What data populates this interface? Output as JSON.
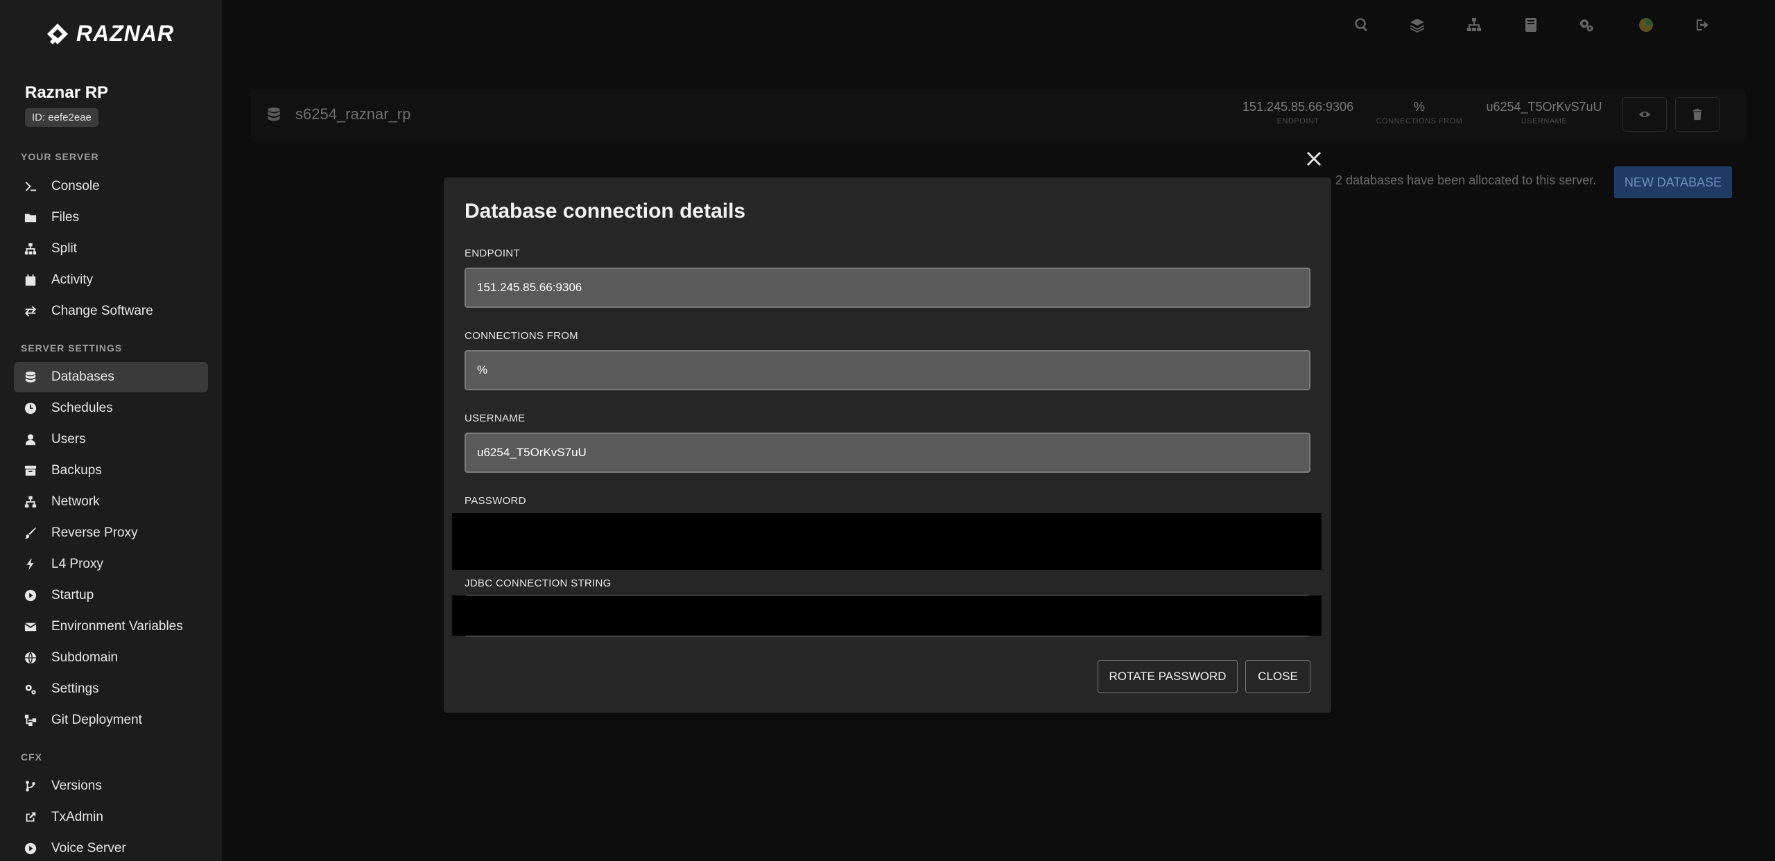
{
  "brand": {
    "logo_text": "RAZNAR"
  },
  "server": {
    "name": "Raznar RP",
    "id_badge": "ID: eefe2eae"
  },
  "sidebar": {
    "sections": [
      {
        "title": "YOUR SERVER"
      },
      {
        "title": "SERVER SETTINGS"
      },
      {
        "title": "CFX"
      }
    ],
    "items": [
      {
        "label": "Console",
        "icon": "terminal-icon"
      },
      {
        "label": "Files",
        "icon": "folder-icon"
      },
      {
        "label": "Split",
        "icon": "sitemap-icon"
      },
      {
        "label": "Activity",
        "icon": "calendar-icon"
      },
      {
        "label": "Change Software",
        "icon": "exchange-icon"
      },
      {
        "label": "Databases",
        "icon": "database-icon",
        "active": true
      },
      {
        "label": "Schedules",
        "icon": "clock-icon"
      },
      {
        "label": "Users",
        "icon": "user-icon"
      },
      {
        "label": "Backups",
        "icon": "archive-icon"
      },
      {
        "label": "Network",
        "icon": "network-icon"
      },
      {
        "label": "Reverse Proxy",
        "icon": "brush-icon"
      },
      {
        "label": "L4 Proxy",
        "icon": "bolt-icon"
      },
      {
        "label": "Startup",
        "icon": "play-circle-icon"
      },
      {
        "label": "Environment Variables",
        "icon": "envelope-icon"
      },
      {
        "label": "Subdomain",
        "icon": "globe-icon"
      },
      {
        "label": "Settings",
        "icon": "cogs-icon"
      },
      {
        "label": "Git Deployment",
        "icon": "git-icon"
      },
      {
        "label": "Versions",
        "icon": "code-branch-icon"
      },
      {
        "label": "TxAdmin",
        "icon": "external-link-icon"
      },
      {
        "label": "Voice Server",
        "icon": "play-circle-icon"
      }
    ]
  },
  "topbar": {
    "icons": [
      "search-icon",
      "layers-icon",
      "sitemap-icon",
      "book-icon",
      "cogs-icon",
      "status-dot-icon",
      "sign-out-icon"
    ]
  },
  "database_row": {
    "name": "s6254_raznar_rp",
    "endpoint": "151.245.85.66:9306",
    "endpoint_label": "ENDPOINT",
    "connections_from": "%",
    "connections_from_label": "CONNECTIONS FROM",
    "username": "u6254_T5OrKvS7uU",
    "username_label": "USERNAME"
  },
  "allocation_text": "2 databases have been allocated to this server.",
  "new_database_label": "NEW DATABASE",
  "modal": {
    "title": "Database connection details",
    "fields": {
      "endpoint": {
        "label": "ENDPOINT",
        "value": "151.245.85.66:9306"
      },
      "connections_from": {
        "label": "CONNECTIONS FROM",
        "value": "%"
      },
      "username": {
        "label": "USERNAME",
        "value": "u6254_T5OrKvS7uU"
      },
      "password": {
        "label": "PASSWORD"
      },
      "jdbc": {
        "label": "JDBC CONNECTION STRING"
      }
    },
    "rotate_label": "ROTATE PASSWORD",
    "close_label": "CLOSE"
  }
}
